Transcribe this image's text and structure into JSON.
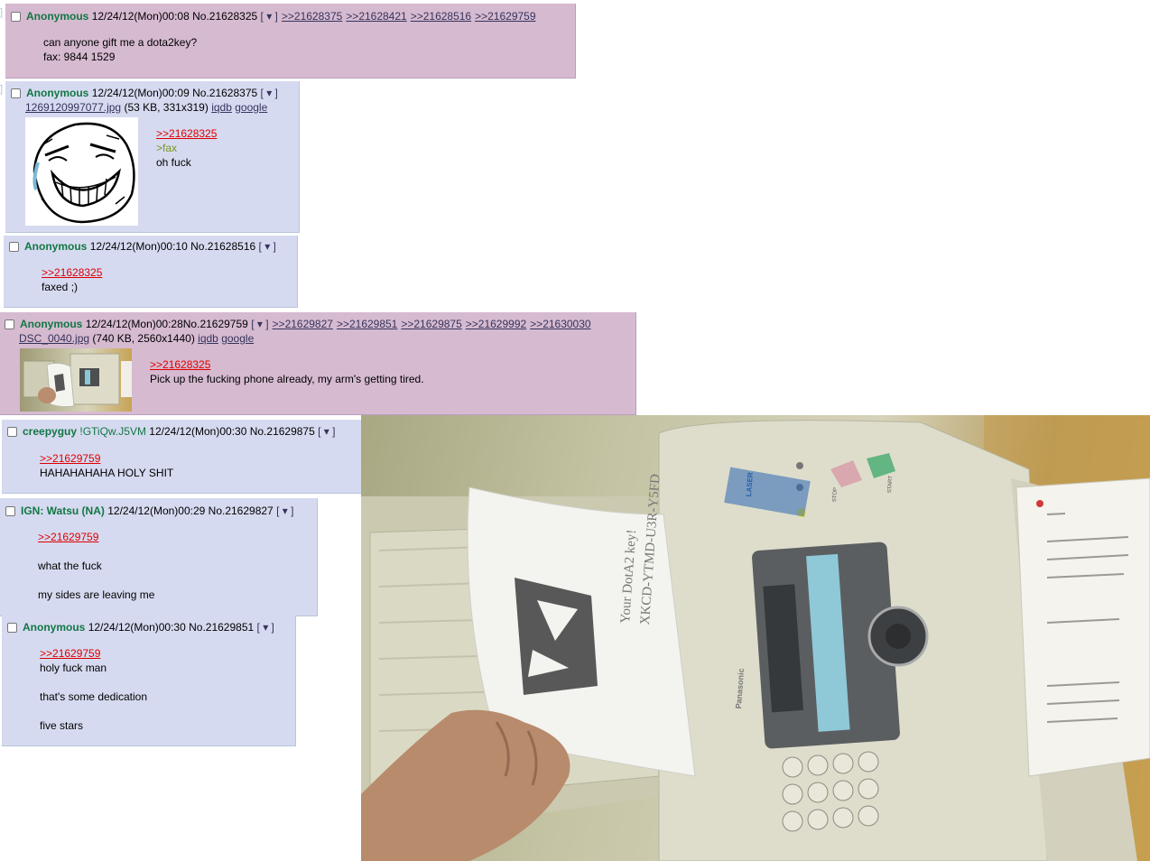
{
  "posts": [
    {
      "name": "Anonymous",
      "datetime": "12/24/12(Mon)00:08",
      "no": "No.21628325",
      "menu": "[ ▾ ]",
      "backlinks": [
        ">>21628375",
        ">>21628421",
        ">>21628516",
        ">>21629759"
      ],
      "lines": [
        "can anyone gift me a dota2key?",
        "fax: 9844 1529"
      ]
    },
    {
      "name": "Anonymous",
      "datetime": "12/24/12(Mon)00:09",
      "no": "No.21628375",
      "menu": "[ ▾ ]",
      "file": {
        "link": "1269120997077.jpg",
        "info": "(53 KB, 331x319)",
        "iqdb": "iqdb",
        "google": "google"
      },
      "thumb_icon": "rage-face-grin-icon",
      "quote": ">>21628325",
      "greentext": ">fax",
      "lines": [
        "oh fuck"
      ]
    },
    {
      "name": "Anonymous",
      "datetime": "12/24/12(Mon)00:10",
      "no": "No.21628516",
      "menu": "[ ▾ ]",
      "quote": ">>21628325",
      "lines": [
        "faxed ;)"
      ]
    },
    {
      "name": "Anonymous",
      "datetime": "12/24/12(Mon)00:28",
      "no": "No.21629759",
      "menu": "[ ▾ ]",
      "backlinks": [
        ">>21629827",
        ">>21629851",
        ">>21629875",
        ">>21629992",
        ">>21630030"
      ],
      "file": {
        "link": "DSC_0040.jpg",
        "info": "(740 KB, 2560x1440)",
        "iqdb": "iqdb",
        "google": "google"
      },
      "thumb_icon": "fax-machine-photo-thumb",
      "quote": ">>21628325",
      "lines": [
        "Pick up the fucking phone already, my arm's getting tired."
      ]
    },
    {
      "name": "creepyguy",
      "tripcode": "!GTiQw.J5VM",
      "datetime": "12/24/12(Mon)00:30",
      "no": "No.21629875",
      "menu": "[ ▾ ]",
      "quote": ">>21629759",
      "lines": [
        "HAHAHAHAHA HOLY SHIT"
      ]
    },
    {
      "name": "IGN: Watsu (NA)",
      "datetime": "12/24/12(Mon)00:29",
      "no": "No.21629827",
      "menu": "[ ▾ ]",
      "quote": ">>21629759",
      "lines": [
        "what the fuck",
        "my sides are leaving me"
      ]
    },
    {
      "name": "Anonymous",
      "datetime": "12/24/12(Mon)00:30",
      "no": "No.21629851",
      "menu": "[ ▾ ]",
      "quote": ">>21629759",
      "lines": [
        "holy fuck man",
        "that's some dedication",
        "five stars"
      ]
    }
  ],
  "expanded_image": {
    "icon": "fax-machine-photo",
    "paper_text_1": "Your DotA2 key!",
    "paper_text_2": "XKCD-YTMD-U3R-Y5FD",
    "start_label": "START",
    "stop_label": "STOP",
    "brand_label": "Panasonic",
    "laser_label": "LASER"
  },
  "colors": {
    "reply_bg": "#d6daf0",
    "highlight_bg": "#d6bad0",
    "name": "#117743",
    "quotelink": "#dd0000",
    "greentext": "#789922"
  }
}
